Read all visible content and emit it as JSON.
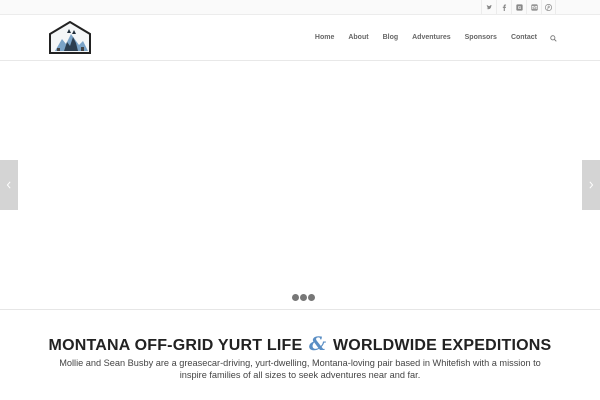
{
  "social": {
    "items": [
      {
        "name": "twitter-icon"
      },
      {
        "name": "facebook-icon"
      },
      {
        "name": "google-plus-icon"
      },
      {
        "name": "email-icon"
      },
      {
        "name": "pinterest-icon"
      }
    ]
  },
  "nav": {
    "items": [
      "Home",
      "About",
      "Blog",
      "Adventures",
      "Sponsors",
      "Contact"
    ]
  },
  "slider": {
    "dot_count": 3
  },
  "intro": {
    "title_left": "MONTANA OFF-GRID YURT LIFE",
    "title_amp": "&",
    "title_right": "WORLDWIDE EXPEDITIONS",
    "description": "Mollie and Sean Busby are a greasecar-driving, yurt-dwelling, Montana-loving pair based in Whitefish with a mission to inspire families of all sizes to seek adventures near and far."
  },
  "colors": {
    "accent": "#5a8ec4",
    "nav_text": "#666666",
    "arrow_bg": "#d4d4d4"
  }
}
